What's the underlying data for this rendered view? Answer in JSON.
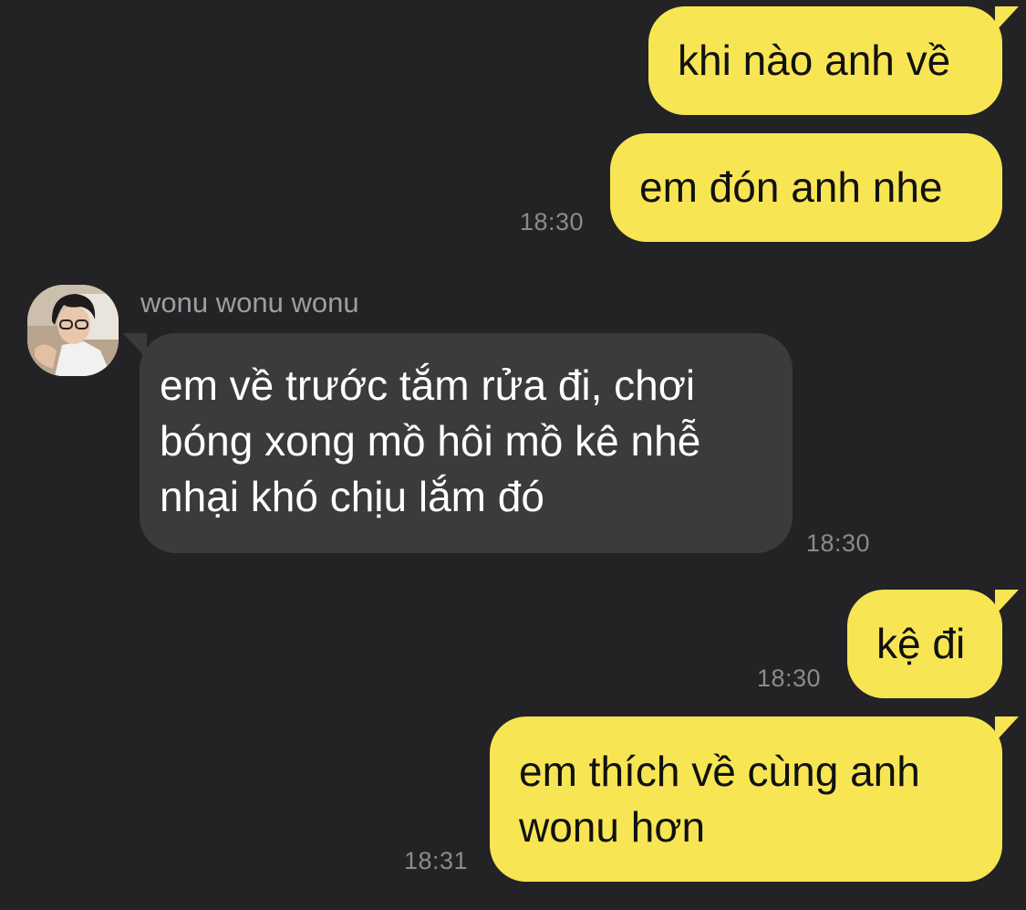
{
  "conversation": {
    "contact": {
      "name": "wonu wonu wonu",
      "avatar_icon": "profile-photo"
    },
    "colors": {
      "background": "#232325",
      "outgoing_bubble": "#f8e553",
      "incoming_bubble": "#3b3b3d",
      "timestamp": "#8b8b8e"
    },
    "messages": [
      {
        "direction": "outgoing",
        "text": "khi nào anh về",
        "time": ""
      },
      {
        "direction": "outgoing",
        "text": "em đón anh nhe",
        "time": "18:30"
      },
      {
        "direction": "incoming",
        "text": "em về trước tắm rửa đi, chơi\nbóng xong mồ hôi mồ kê nhễ\nnhại khó chịu lắm đó",
        "time": "18:30"
      },
      {
        "direction": "outgoing",
        "text": "kệ đi",
        "time": "18:30"
      },
      {
        "direction": "outgoing",
        "text": "em thích về cùng anh\nwonu hơn",
        "time": "18:31"
      }
    ]
  }
}
